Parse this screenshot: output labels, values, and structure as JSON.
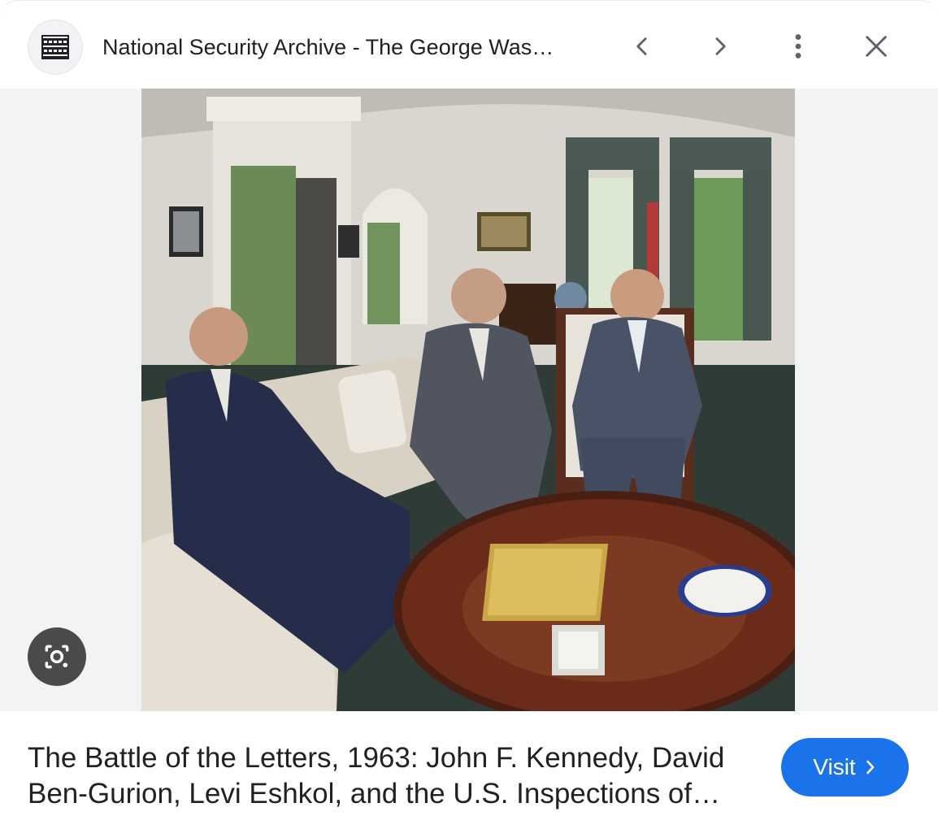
{
  "header": {
    "site_title": "National Security Archive - The George Was…",
    "favicon": "archive-logo-icon",
    "prev_icon": "chevron-left-icon",
    "next_icon": "chevron-right-icon",
    "more_icon": "more-vert-icon",
    "close_icon": "close-icon"
  },
  "image": {
    "lens_icon": "google-lens-icon"
  },
  "footer": {
    "caption_line1": "The Battle of the Letters, 1963: John F. Kennedy, David",
    "caption_line2": "Ben-Gurion, Levi Eshkol, and the U.S. Inspections of…",
    "visit_label": "Visit",
    "visit_icon": "chevron-right-icon"
  },
  "colors": {
    "accent": "#1a73e8",
    "icon": "#5f6368",
    "image_bg": "#f1f3f4",
    "lens_bg": "#4a4a4a"
  }
}
